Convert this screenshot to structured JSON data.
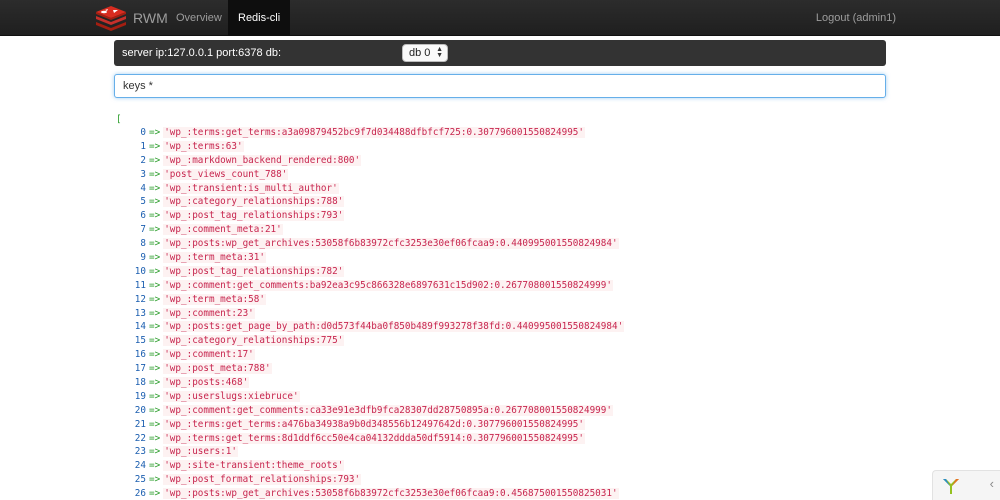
{
  "navbar": {
    "brand": "RWM",
    "links": [
      {
        "label": "Overview"
      },
      {
        "label": "Redis-cli"
      }
    ],
    "logout": "Logout (admin1)"
  },
  "server": {
    "info": "server ip:127.0.0.1 port:6378 db:",
    "db_selected": "db 0"
  },
  "command": {
    "value": "keys *"
  },
  "output": {
    "open": "[",
    "arrow": "=>",
    "rows": [
      {
        "i": "0",
        "v": "'wp_:terms:get_terms:a3a09879452bc9f7d034488dfbfcf725:0.307796001550824995'"
      },
      {
        "i": "1",
        "v": "'wp_:terms:63'"
      },
      {
        "i": "2",
        "v": "'wp_:markdown_backend_rendered:800'"
      },
      {
        "i": "3",
        "v": "'post_views_count_788'"
      },
      {
        "i": "4",
        "v": "'wp_:transient:is_multi_author'"
      },
      {
        "i": "5",
        "v": "'wp_:category_relationships:788'"
      },
      {
        "i": "6",
        "v": "'wp_:post_tag_relationships:793'"
      },
      {
        "i": "7",
        "v": "'wp_:comment_meta:21'"
      },
      {
        "i": "8",
        "v": "'wp_:posts:wp_get_archives:53058f6b83972cfc3253e30ef06fcaa9:0.440995001550824984'"
      },
      {
        "i": "9",
        "v": "'wp_:term_meta:31'"
      },
      {
        "i": "10",
        "v": "'wp_:post_tag_relationships:782'"
      },
      {
        "i": "11",
        "v": "'wp_:comment:get_comments:ba92ea3c95c866328e6897631c15d902:0.267708001550824999'"
      },
      {
        "i": "12",
        "v": "'wp_:term_meta:58'"
      },
      {
        "i": "13",
        "v": "'wp_:comment:23'"
      },
      {
        "i": "14",
        "v": "'wp_:posts:get_page_by_path:d0d573f44ba0f850b489f993278f38fd:0.440995001550824984'"
      },
      {
        "i": "15",
        "v": "'wp_:category_relationships:775'"
      },
      {
        "i": "16",
        "v": "'wp_:comment:17'"
      },
      {
        "i": "17",
        "v": "'wp_:post_meta:788'"
      },
      {
        "i": "18",
        "v": "'wp_:posts:468'"
      },
      {
        "i": "19",
        "v": "'wp_:userslugs:xiebruce'"
      },
      {
        "i": "20",
        "v": "'wp_:comment:get_comments:ca33e91e3dfb9fca28307dd28750895a:0.267708001550824999'"
      },
      {
        "i": "21",
        "v": "'wp_:terms:get_terms:a476ba34938a9b0d348556b12497642d:0.307796001550824995'"
      },
      {
        "i": "22",
        "v": "'wp_:terms:get_terms:8d1ddf6cc50e4ca04132ddda50df5914:0.307796001550824995'"
      },
      {
        "i": "23",
        "v": "'wp_:users:1'"
      },
      {
        "i": "24",
        "v": "'wp_:site-transient:theme_roots'"
      },
      {
        "i": "25",
        "v": "'wp_:post_format_relationships:793'"
      },
      {
        "i": "26",
        "v": "'wp_:posts:wp_get_archives:53058f6b83972cfc3253e30ef06fcaa9:0.456875001550825031'"
      }
    ]
  },
  "debug": {
    "toggle": "‹"
  },
  "colors": {
    "navbar_bg": "#222222",
    "server_bar_bg": "#333333",
    "index": "#1c5fb0",
    "arrow": "#2a9d2a",
    "value": "#c7254e",
    "value_bg": "#fdf2f2"
  },
  "icons": [
    "redis-logo-icon",
    "yii-logo-icon",
    "chevron-left-icon",
    "updown-arrows-icon"
  ]
}
